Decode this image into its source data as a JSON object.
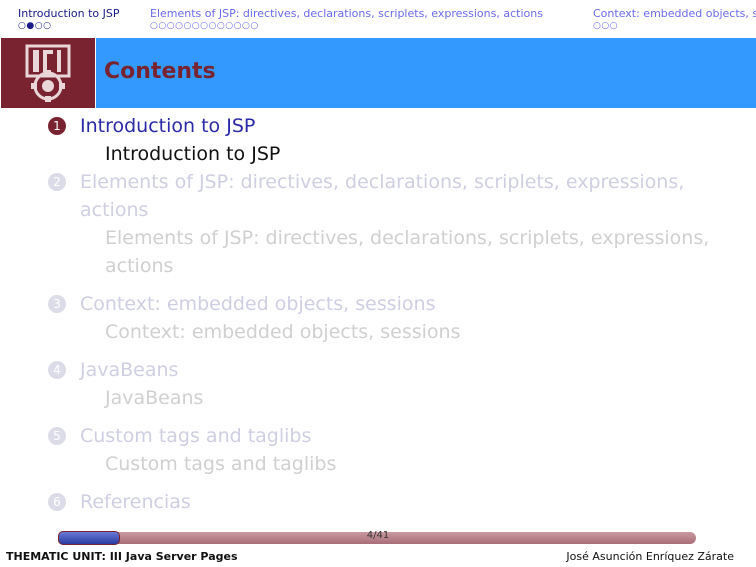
{
  "nav": {
    "sections": [
      {
        "label": "Introduction to JSP",
        "dots": [
          "○",
          "●",
          "○",
          "○"
        ],
        "active": true
      },
      {
        "label": "Elements of JSP: directives, declarations, scriplets, expressions, actions",
        "dots": [
          "○",
          "○",
          "○",
          "○",
          "○",
          "○",
          "○",
          "○",
          "○",
          "○",
          "○",
          "○",
          "○"
        ],
        "active": false
      },
      {
        "label": "Context: embedded objects, sessions",
        "dots": [
          "○",
          "○",
          "○"
        ],
        "active": false
      }
    ]
  },
  "header": {
    "title": "Contents"
  },
  "toc": {
    "sections": [
      {
        "number": "1",
        "title": "Introduction to JSP",
        "sub": "Introduction to JSP"
      },
      {
        "number": "2",
        "title": "Elements of JSP: directives, declarations, scriplets, expressions, actions",
        "sub": "Elements of JSP: directives, declarations, scriplets, expressions, actions"
      },
      {
        "number": "3",
        "title": "Context: embedded objects, sessions",
        "sub": "Context: embedded objects, sessions"
      },
      {
        "number": "4",
        "title": "JavaBeans",
        "sub": "JavaBeans"
      },
      {
        "number": "5",
        "title": "Custom tags and taglibs",
        "sub": "Custom tags and taglibs"
      },
      {
        "number": "6",
        "title": "Referencias"
      }
    ]
  },
  "footer": {
    "page": "4/41",
    "current_page": 4,
    "total_pages": 41,
    "left": "THEMATIC UNIT: III Java Server Pages",
    "right": "José Asunción Enríquez Zárate"
  },
  "colors": {
    "header_bg": "#3399ff",
    "accent": "#7a2330",
    "active_text": "#2a2aa8"
  }
}
